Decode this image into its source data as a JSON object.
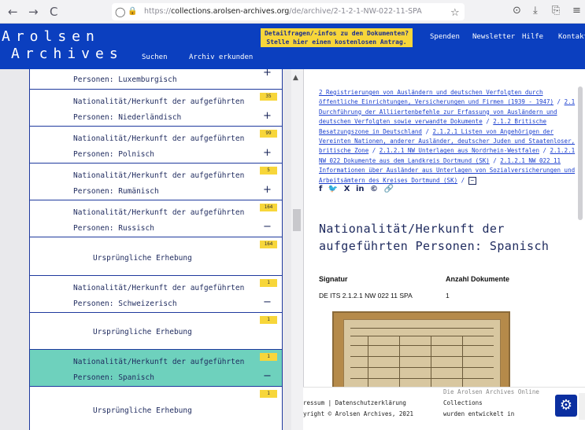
{
  "browser": {
    "back": "←",
    "forward": "→",
    "reload": "C",
    "shield": "◯",
    "lock": "🔒",
    "url_prefix": "https://",
    "url_host": "collections.arolsen-archives.org",
    "url_path": "/de/archive/2-1-2-1-NW-022-11-SPA",
    "star": "☆",
    "pocket": "⊙",
    "download": "⤓",
    "share": "⎘",
    "menu": "≡"
  },
  "header": {
    "logo_line1": "Arolsen",
    "logo_line2": "Archives",
    "nav": [
      "Suchen",
      "Archiv erkunden"
    ],
    "notice_line1": "Detailfragen/-infos zu den Dokumenten?",
    "notice_line2": "Stelle hier einen kostenlosen Antrag.",
    "links": [
      "Spenden",
      "Newsletter",
      "Hilfe",
      "Kontakt"
    ],
    "accent_color": "#0b3fbf",
    "notice_color": "#f7d63a"
  },
  "tree": {
    "top_partial": "Personen: Luxemburgisch",
    "top_toggle": "+",
    "rows": [
      {
        "line1": "Nationalität/Herkunft der aufgeführten",
        "line2": "Personen: Niederländisch",
        "count": "35",
        "toggle": "+"
      },
      {
        "line1": "Nationalität/Herkunft der aufgeführten",
        "line2": "Personen: Polnisch",
        "count": "99",
        "toggle": "+"
      },
      {
        "line1": "Nationalität/Herkunft der aufgeführten",
        "line2": "Personen: Rumänisch",
        "count": "5",
        "toggle": "+"
      },
      {
        "line1": "Nationalität/Herkunft der aufgeführten",
        "line2": "Personen: Russisch",
        "count": "164",
        "toggle": "−"
      },
      {
        "sub": "Ursprüngliche Erhebung",
        "count": "164"
      },
      {
        "line1": "Nationalität/Herkunft der aufgeführten",
        "line2": "Personen: Schweizerisch",
        "count": "1",
        "toggle": "−"
      },
      {
        "sub": "Ursprüngliche Erhebung",
        "count": "1"
      },
      {
        "line1": "Nationalität/Herkunft der aufgeführten",
        "line2": "Personen: Spanisch",
        "count": "1",
        "toggle": "−"
      },
      {
        "sub": "Ursprüngliche Erhebung",
        "count": "1"
      }
    ],
    "active_color": "#6ed1bd"
  },
  "detail": {
    "breadcrumb": [
      "2 Registrierungen von Ausländern und deutschen Verfolgten durch öffentliche Einrichtungen, Versicherungen und Firmen (1939 - 1947)",
      "2.1 Durchführung der Alliiertenbefehle zur Erfassung von Ausländern und deutschen Verfolgten sowie verwandte Dokumente",
      "2.1.2 Britische Besatzungszone in Deutschland",
      "2.1.2.1 Listen von Angehörigen der Vereinten Nationen, anderer Ausländer, deutscher Juden und Staatenloser, britische Zone",
      "2.1.2.1 NW Unterlagen aus Nordrhein-Westfalen",
      "2.1.2.1 NW 022 Dokumente aus dem Landkreis Dortmund (SK)",
      "2.1.2.1 NW 022 11 Informationen über Ausländer aus Unterlagen von Sozialversicherungen und Arbeitsämtern des Kreises Dortmund (SK)"
    ],
    "breadcrumb_sep": " / ",
    "collapse_icon": "−",
    "socials": [
      "f",
      "🐦",
      "X",
      "in",
      "©",
      "🔗"
    ],
    "title": "Nationalität/Herkunft der aufgeführten Personen: Spanisch",
    "signatur_label": "Signatur",
    "signatur_value": "DE ITS 2.1.2.1 NW 022 11 SPA",
    "anzahl_label": "Anzahl Dokumente",
    "anzahl_value": "1"
  },
  "footer": {
    "left_line1": "ressum  |  Datenschutzerklärung",
    "left_line2": "yright © Arolsen Archives, 2021",
    "mid_line0": "Die Arolsen Archives Online",
    "mid_line1": "Collections",
    "mid_line2": "wurden entwickelt in",
    "gear": "⚙"
  }
}
